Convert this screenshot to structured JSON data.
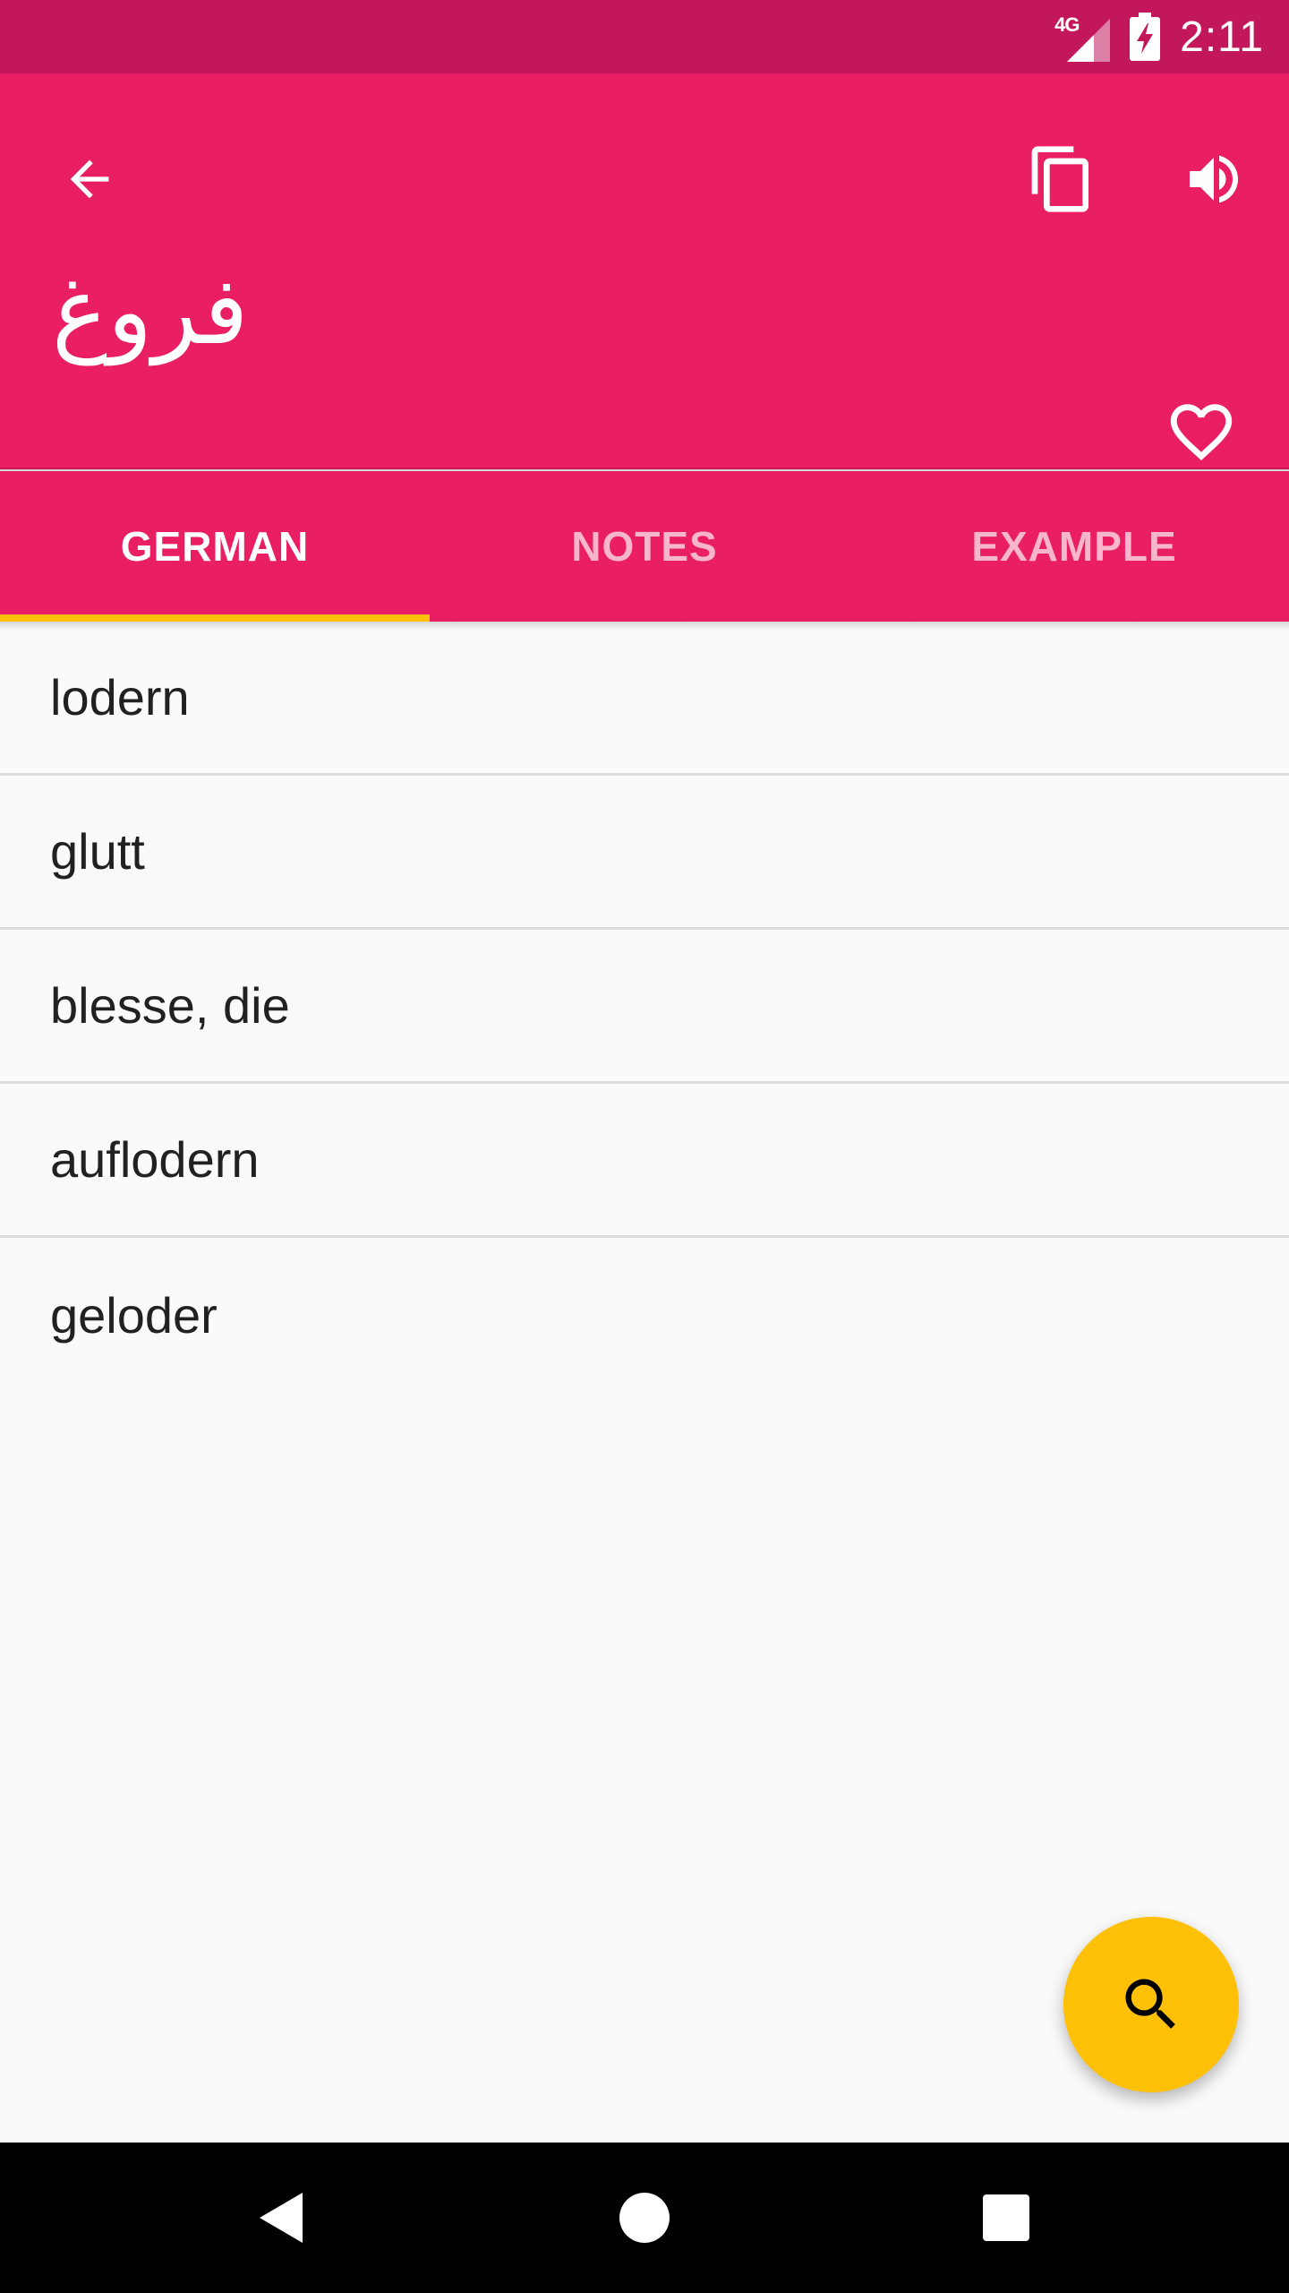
{
  "status_bar": {
    "network_label": "4G",
    "time": "2:11"
  },
  "app_bar": {
    "word": "فروغ",
    "icons": {
      "back": "arrow-back-icon",
      "copy": "copy-icon",
      "speaker": "volume-up-icon",
      "favorite": "heart-outline-icon"
    }
  },
  "tabs": [
    {
      "label": "GERMAN",
      "active": true
    },
    {
      "label": "NOTES",
      "active": false
    },
    {
      "label": "EXAMPLE",
      "active": false
    }
  ],
  "translations": [
    "lodern",
    "glutt",
    "blesse, die",
    "auflodern",
    "geloder"
  ],
  "fab": {
    "icon": "search-icon"
  },
  "nav_bar": {
    "icons": [
      "back-triangle-icon",
      "home-circle-icon",
      "recents-square-icon"
    ]
  },
  "colors": {
    "status_bar": "#c2185b",
    "primary": "#e91e63",
    "accent": "#ffc107",
    "background": "#fafafa"
  }
}
